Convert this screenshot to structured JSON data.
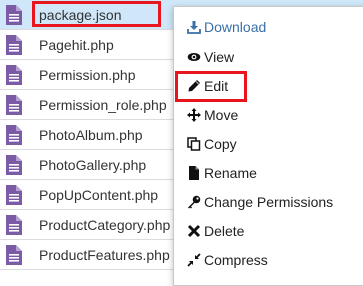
{
  "files": [
    {
      "name": "package.json",
      "selected": true
    },
    {
      "name": "Pagehit.php"
    },
    {
      "name": "Permission.php"
    },
    {
      "name": "Permission_role.php"
    },
    {
      "name": "PhotoAlbum.php"
    },
    {
      "name": "PhotoGallery.php"
    },
    {
      "name": "PopUpContent.php"
    },
    {
      "name": "ProductCategory.php"
    },
    {
      "name": "ProductFeatures.php"
    }
  ],
  "context_menu": {
    "download": "Download",
    "view": "View",
    "edit": "Edit",
    "move": "Move",
    "copy": "Copy",
    "rename": "Rename",
    "change_permissions": "Change Permissions",
    "delete": "Delete",
    "compress": "Compress"
  },
  "colors": {
    "file_icon": "#7b5aa6",
    "selected_row": "#cfe7f8",
    "highlight": "#e8141e",
    "download_text": "#3a6fa8"
  }
}
